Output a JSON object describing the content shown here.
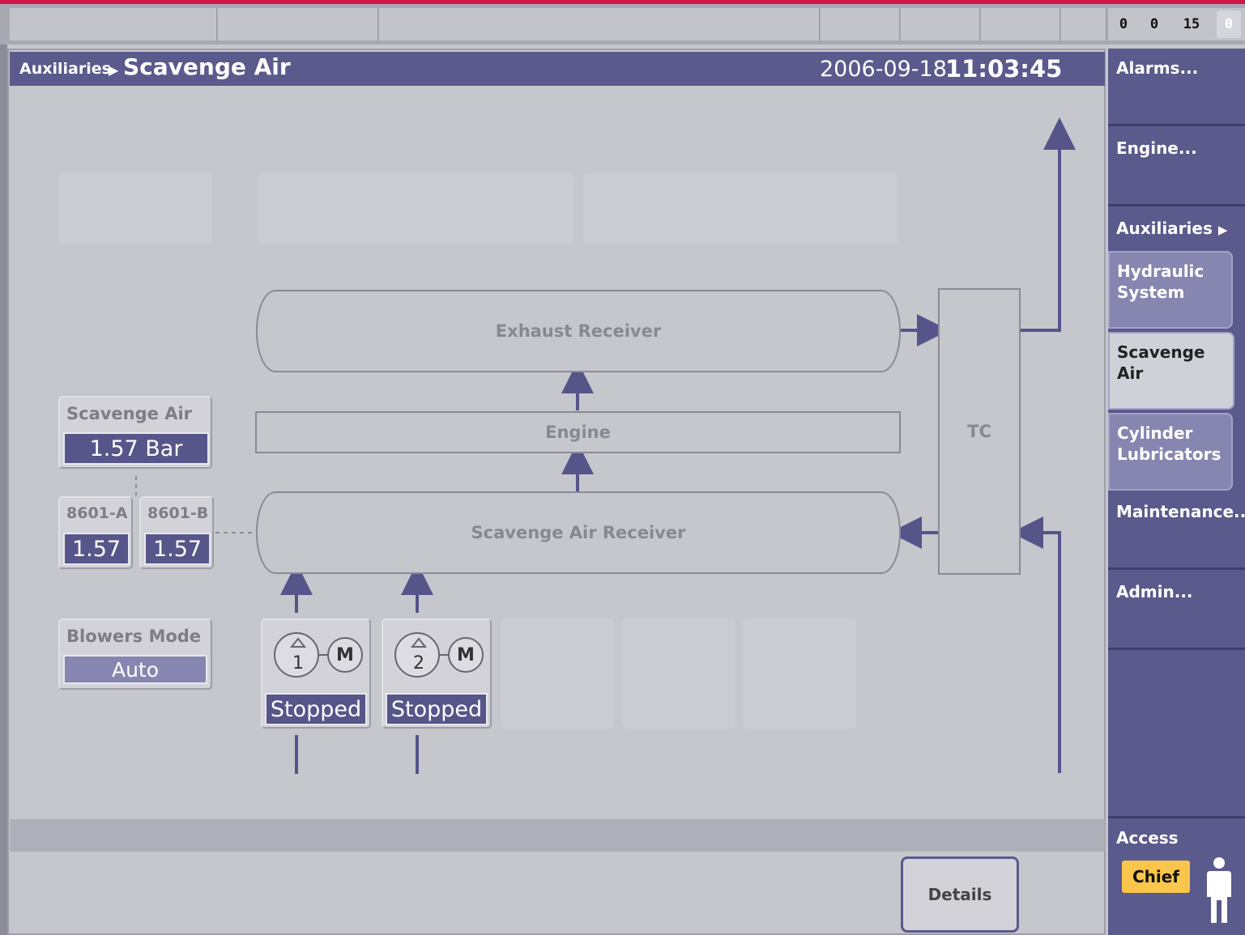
{
  "header": {
    "breadcrumb_parent": "Auxiliaries",
    "title": "Scavenge Air",
    "date": "2006-09-18",
    "time": "11:03:45"
  },
  "counters": [
    "0",
    "0",
    "15",
    "0"
  ],
  "diagram": {
    "exhaust_receiver": "Exhaust Receiver",
    "engine": "Engine",
    "scavenge_air_receiver": "Scavenge Air Receiver",
    "tc": "TC"
  },
  "scavenge_air": {
    "label": "Scavenge Air",
    "value": "1.57 Bar"
  },
  "sensors": [
    {
      "label": "8601-A",
      "value": "1.57"
    },
    {
      "label": "8601-B",
      "value": "1.57"
    }
  ],
  "blowers_mode": {
    "label": "Blowers Mode",
    "value": "Auto"
  },
  "blowers": [
    {
      "number": "1",
      "motor": "M",
      "status": "Stopped"
    },
    {
      "number": "2",
      "motor": "M",
      "status": "Stopped"
    }
  ],
  "details_button": "Details",
  "menu": {
    "alarms": "Alarms...",
    "engine": "Engine...",
    "auxiliaries": "Auxiliaries",
    "sub": [
      {
        "line1": "Hydraulic",
        "line2": "System"
      },
      {
        "line1": "Scavenge",
        "line2": "Air"
      },
      {
        "line1": "Cylinder",
        "line2": "Lubricators"
      }
    ],
    "maintenance": "Maintenance...",
    "admin": "Admin...",
    "access_label": "Access",
    "access_level": "Chief"
  },
  "colors": {
    "accent": "#5a5a8c",
    "alert_line": "#d2154a",
    "access_badge": "#f9c54a"
  }
}
